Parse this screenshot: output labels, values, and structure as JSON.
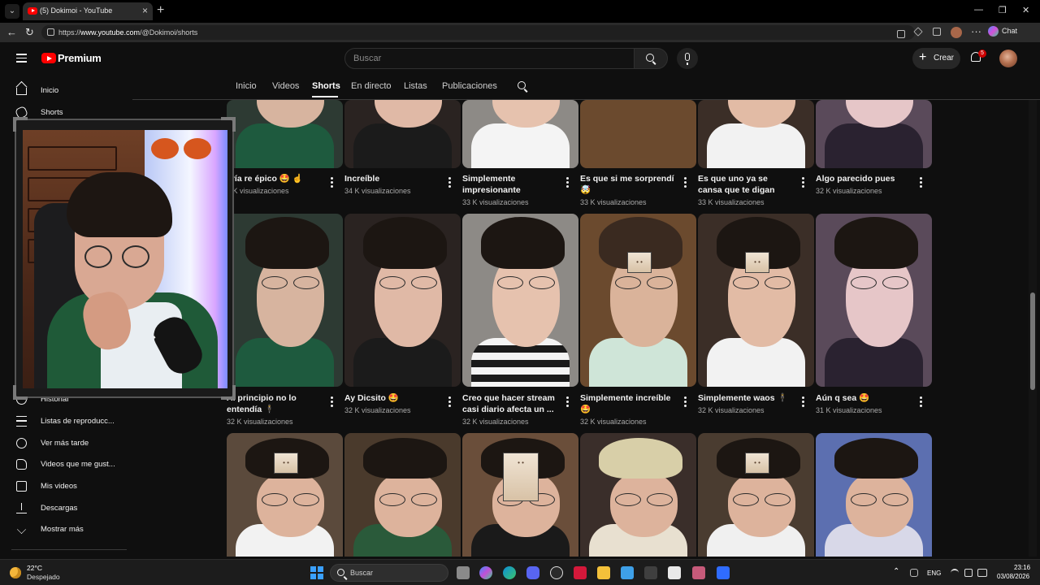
{
  "browser": {
    "tab_title": "(5) Dokimoi - YouTube",
    "url_prefix": "https://",
    "url_host": "www.youtube.com",
    "url_path": "/@Dokimoi/shorts",
    "chat_label": "Chat"
  },
  "masthead": {
    "logo_text": "Premium",
    "search_placeholder": "Buscar",
    "create_label": "Crear",
    "notifications_count": "5"
  },
  "channel_tabs": [
    {
      "label": "Inicio",
      "active": false
    },
    {
      "label": "Videos",
      "active": false
    },
    {
      "label": "Shorts",
      "active": true
    },
    {
      "label": "En directo",
      "active": false
    },
    {
      "label": "Listas",
      "active": false
    },
    {
      "label": "Publicaciones",
      "active": false
    }
  ],
  "sidebar": {
    "items": [
      {
        "label": "Inicio",
        "icon": "home-icon"
      },
      {
        "label": "Shorts",
        "icon": "shorts-icon"
      },
      {
        "label": "Historial",
        "icon": "history-icon"
      },
      {
        "label": "Listas de reproducc...",
        "icon": "playlist-icon"
      },
      {
        "label": "Ver más tarde",
        "icon": "watch-later-icon"
      },
      {
        "label": "Videos que me gust...",
        "icon": "like-icon"
      },
      {
        "label": "Mis videos",
        "icon": "my-videos-icon"
      },
      {
        "label": "Descargas",
        "icon": "download-icon"
      },
      {
        "label": "Mostrar más",
        "icon": "chevron-down-icon"
      }
    ]
  },
  "shorts": {
    "row1": [
      {
        "title": "ería re épico 🤩 ☝️",
        "views": "5 K visualizaciones"
      },
      {
        "title": "Increíble",
        "views": "34 K visualizaciones"
      },
      {
        "title": "Simplemente impresionante",
        "views": "33 K visualizaciones"
      },
      {
        "title": "Es que si me sorprendí 🤯",
        "views": "33 K visualizaciones"
      },
      {
        "title": "Es que uno ya se cansa que te digan estas cos...",
        "views": "33 K visualizaciones"
      },
      {
        "title": "Algo parecido pues",
        "views": "32 K visualizaciones"
      }
    ],
    "row2": [
      {
        "title": "Al principio no lo entendía 🕴️",
        "views": "32 K visualizaciones"
      },
      {
        "title": "Ay Dicsito 🤩",
        "views": "32 K visualizaciones"
      },
      {
        "title": "Creo que hacer stream casi diario afecta un ...",
        "views": "32 K visualizaciones"
      },
      {
        "title": "Simplemente increíble 🤩",
        "views": "32 K visualizaciones"
      },
      {
        "title": "Simplemente waos 🕴️",
        "views": "32 K visualizaciones"
      },
      {
        "title": "Aún q sea 🤩",
        "views": "31 K visualizaciones"
      }
    ]
  },
  "taskbar": {
    "temperature": "22°C",
    "weather": "Despejado",
    "search_label": "Buscar",
    "language": "ENG",
    "time": "23:16",
    "date": "03/08/2026"
  },
  "colors": {
    "background": "#0f0f0f",
    "youtube_red": "#ff0000",
    "text_primary": "#f1f1f1",
    "text_secondary": "#aaaaaa"
  }
}
